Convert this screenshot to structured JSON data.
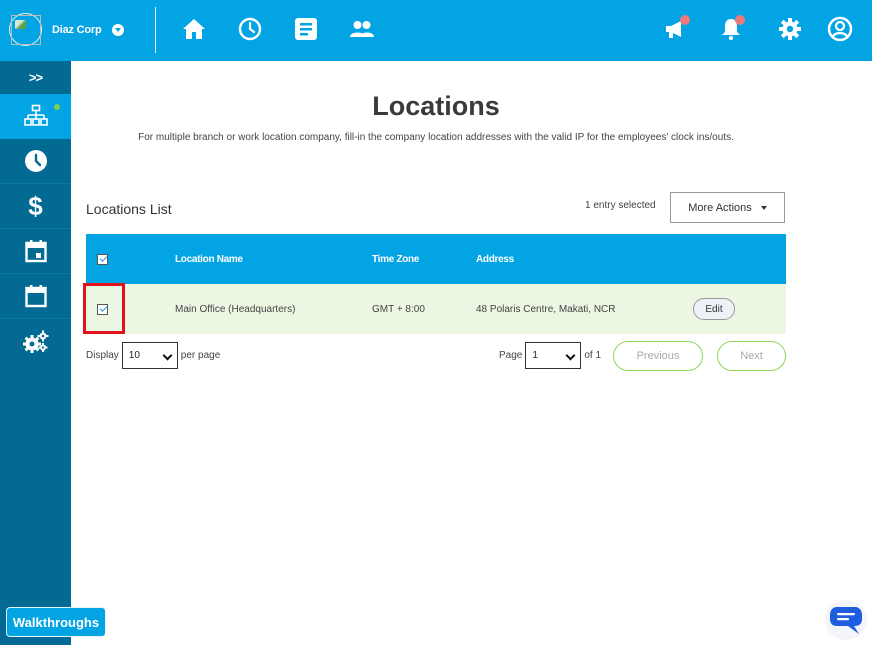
{
  "header": {
    "company_name": "Diaz Corp",
    "nav_icons": [
      "home-icon",
      "clock-icon",
      "document-icon",
      "people-icon"
    ],
    "right_icons": [
      "announcement-icon",
      "bell-icon",
      "gear-icon",
      "user-icon"
    ],
    "badge_color": "#f07a7a",
    "brand_color": "#03a4e3"
  },
  "sidebar": {
    "toggle_label": ">>",
    "items": [
      {
        "icon": "org-chart-icon",
        "active": true,
        "status_dot": true
      },
      {
        "icon": "clock-icon",
        "active": false
      },
      {
        "icon": "dollar-icon",
        "active": false
      },
      {
        "icon": "calendar-day-icon",
        "active": false
      },
      {
        "icon": "calendar-icon",
        "active": false
      },
      {
        "icon": "gears-icon",
        "active": false
      }
    ],
    "background_color": "#036a94"
  },
  "main": {
    "title": "Locations",
    "description": "For multiple branch or work location company, fill-in the company location addresses with the valid IP for the employees' clock ins/outs.",
    "list_title": "Locations List",
    "selected_count": "1 entry selected",
    "more_actions_label": "More Actions",
    "table": {
      "columns": [
        "Location Name",
        "Time Zone",
        "Address"
      ],
      "rows": [
        {
          "selected": true,
          "location_name": "Main Office (Headquarters)",
          "time_zone": "GMT + 8:00",
          "address": "48 Polaris Centre, Makati, NCR",
          "action_label": "Edit"
        }
      ],
      "header_checked": true
    },
    "pagination": {
      "display_label": "Display",
      "per_page_value": "10",
      "per_page_label": "per page",
      "page_label": "Page",
      "page_value": "1",
      "of_label": "of 1",
      "previous_label": "Previous",
      "next_label": "Next"
    }
  },
  "walkthroughs_label": "Walkthroughs",
  "chat_icon": "chat-icon"
}
